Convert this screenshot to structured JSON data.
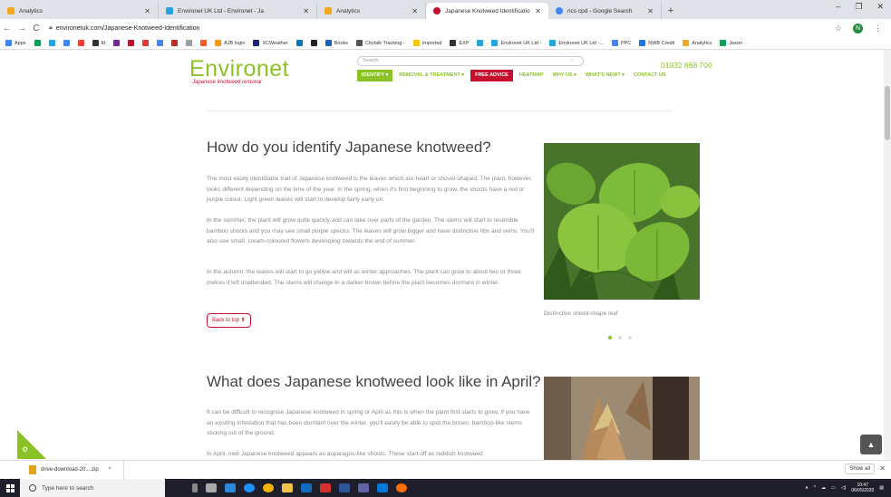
{
  "browser": {
    "tabs": [
      {
        "title": "Analytics",
        "color": "#f4a81d"
      },
      {
        "title": "Environet UK Ltd - Environet - Ja",
        "color": "#27a3dd"
      },
      {
        "title": "Analytics",
        "color": "#f4a81d"
      },
      {
        "title": "Japanese Knotweed Identificatio",
        "color": "#c8102e",
        "active": true
      },
      {
        "title": "rics cpd - Google Search",
        "color": "#4285f4"
      }
    ],
    "new_tab": "+",
    "window_controls": [
      "–",
      "❐",
      "✕"
    ],
    "url": "environetuk.com/Japanese-Knotweed-Identification",
    "nav": {
      "back": "←",
      "forward": "→",
      "reload": "C"
    },
    "star": "☆",
    "profile_letter": "N",
    "menu": "⋮",
    "bookmarks": [
      {
        "label": "Apps",
        "color": "#4285f4"
      },
      {
        "label": "",
        "color": "#0f9d58"
      },
      {
        "label": "",
        "color": "#27a3dd"
      },
      {
        "label": "",
        "color": "#4285f4"
      },
      {
        "label": "",
        "color": "#ea4335"
      },
      {
        "label": "fd",
        "color": "#333333"
      },
      {
        "label": "",
        "color": "#7b1fa2"
      },
      {
        "label": "",
        "color": "#c8102e"
      },
      {
        "label": "",
        "color": "#e53935"
      },
      {
        "label": "",
        "color": "#4285f4"
      },
      {
        "label": "",
        "color": "#c62828"
      },
      {
        "label": "",
        "color": "#9e9e9e"
      },
      {
        "label": "",
        "color": "#ff5722"
      },
      {
        "label": "AJB login",
        "color": "#ff9800"
      },
      {
        "label": "XCWeather",
        "color": "#1a237e"
      },
      {
        "label": "",
        "color": "#0277bd"
      },
      {
        "label": "",
        "color": "#212121"
      },
      {
        "label": "Books",
        "color": "#1565c0"
      },
      {
        "label": "Citytalk Tracking -",
        "color": "#555555"
      },
      {
        "label": "Imported",
        "color": "#f9c400"
      },
      {
        "label": "EXP",
        "color": "#333333"
      },
      {
        "label": "",
        "color": "#27a3dd"
      },
      {
        "label": "Environet UK Ltd -",
        "color": "#27a3dd"
      },
      {
        "label": "Environet UK Ltd -...",
        "color": "#27a3dd"
      },
      {
        "label": "PPC",
        "color": "#4285f4"
      },
      {
        "label": "NWB Credit",
        "color": "#1a73e8"
      },
      {
        "label": "Analytics",
        "color": "#f4a81d"
      },
      {
        "label": "Jason",
        "color": "#0f9d58"
      }
    ]
  },
  "site": {
    "logo": "Environet",
    "tagline": "Japanese knotweed removal",
    "search_placeholder": "Search",
    "phone": "01932 868 700",
    "menu": {
      "identify": "IDENTIFY ▾",
      "removal": "REMOVAL & TREATMENT ▾",
      "advice": "FREE ADVICE",
      "heatmap": "HEATMAP",
      "why": "WHY US ▾",
      "news": "WHAT'S NEW? ▾",
      "contact": "CONTACT US"
    },
    "colors": {
      "brand_green": "#8bc226",
      "brand_red": "#c8102e"
    }
  },
  "section1": {
    "heading": "How do you identify Japanese knotweed?",
    "p1": "The most easily identifiable trait of Japanese knotweed is the leaves which are heart or shovel-shaped. The plant, however, looks different depending on the time of the year. In the spring, when it's first beginning to grow, the shoots have a red or purple colour. Light green leaves will start to develop fairly early on.",
    "p2": "In the summer, the plant will grow quite quickly and can take over parts of the garden. The stems will start to resemble bamboo shoots and you may see small purple specks. The leaves will grow bigger and have distinctive ribs and veins. You'll also see small, cream-coloured flowers developing towards the end of summer.",
    "p3": "In the autumn, the leaves will start to go yellow and will as winter approaches. The plant can grow to about two or three metres if left unattended. The stems will change to a darker brown before the plant becomes dormant in winter.",
    "back_to_top": "Back to top ⬆",
    "caption": "Distinctive shield-shape leaf",
    "slide_index": 1,
    "slide_count": 3
  },
  "section2": {
    "heading": "What does Japanese knotweed look like in April?",
    "p1": "It can be difficult to recognise Japanese knotweed in spring or April as this is when the plant first starts to grow. If you have an existing infestation that has been dormant over the winter, you'll easily be able to spot the brown, bamboo-like stems sticking out of the ground.",
    "p2": "In April, new Japanese knotweed appears as asparagus-like shoots. These start off as reddish knotweed"
  },
  "downloads": {
    "file": "drive-download-20....zip",
    "chevron": "^",
    "show_all": "Show all",
    "close": "✕"
  },
  "taskbar": {
    "search_placeholder": "Type here to search",
    "time": "10:47",
    "date": "06/05/2020"
  }
}
